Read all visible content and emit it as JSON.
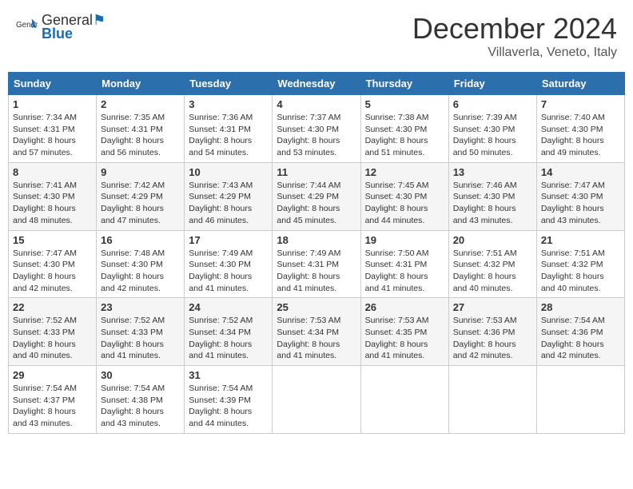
{
  "header": {
    "logo_general": "General",
    "logo_blue": "Blue",
    "month_title": "December 2024",
    "location": "Villaverla, Veneto, Italy"
  },
  "columns": [
    "Sunday",
    "Monday",
    "Tuesday",
    "Wednesday",
    "Thursday",
    "Friday",
    "Saturday"
  ],
  "weeks": [
    [
      {
        "day": "1",
        "sunrise": "7:34 AM",
        "sunset": "4:31 PM",
        "daylight": "8 hours and 57 minutes."
      },
      {
        "day": "2",
        "sunrise": "7:35 AM",
        "sunset": "4:31 PM",
        "daylight": "8 hours and 56 minutes."
      },
      {
        "day": "3",
        "sunrise": "7:36 AM",
        "sunset": "4:31 PM",
        "daylight": "8 hours and 54 minutes."
      },
      {
        "day": "4",
        "sunrise": "7:37 AM",
        "sunset": "4:30 PM",
        "daylight": "8 hours and 53 minutes."
      },
      {
        "day": "5",
        "sunrise": "7:38 AM",
        "sunset": "4:30 PM",
        "daylight": "8 hours and 51 minutes."
      },
      {
        "day": "6",
        "sunrise": "7:39 AM",
        "sunset": "4:30 PM",
        "daylight": "8 hours and 50 minutes."
      },
      {
        "day": "7",
        "sunrise": "7:40 AM",
        "sunset": "4:30 PM",
        "daylight": "8 hours and 49 minutes."
      }
    ],
    [
      {
        "day": "8",
        "sunrise": "7:41 AM",
        "sunset": "4:30 PM",
        "daylight": "8 hours and 48 minutes."
      },
      {
        "day": "9",
        "sunrise": "7:42 AM",
        "sunset": "4:29 PM",
        "daylight": "8 hours and 47 minutes."
      },
      {
        "day": "10",
        "sunrise": "7:43 AM",
        "sunset": "4:29 PM",
        "daylight": "8 hours and 46 minutes."
      },
      {
        "day": "11",
        "sunrise": "7:44 AM",
        "sunset": "4:29 PM",
        "daylight": "8 hours and 45 minutes."
      },
      {
        "day": "12",
        "sunrise": "7:45 AM",
        "sunset": "4:30 PM",
        "daylight": "8 hours and 44 minutes."
      },
      {
        "day": "13",
        "sunrise": "7:46 AM",
        "sunset": "4:30 PM",
        "daylight": "8 hours and 43 minutes."
      },
      {
        "day": "14",
        "sunrise": "7:47 AM",
        "sunset": "4:30 PM",
        "daylight": "8 hours and 43 minutes."
      }
    ],
    [
      {
        "day": "15",
        "sunrise": "7:47 AM",
        "sunset": "4:30 PM",
        "daylight": "8 hours and 42 minutes."
      },
      {
        "day": "16",
        "sunrise": "7:48 AM",
        "sunset": "4:30 PM",
        "daylight": "8 hours and 42 minutes."
      },
      {
        "day": "17",
        "sunrise": "7:49 AM",
        "sunset": "4:30 PM",
        "daylight": "8 hours and 41 minutes."
      },
      {
        "day": "18",
        "sunrise": "7:49 AM",
        "sunset": "4:31 PM",
        "daylight": "8 hours and 41 minutes."
      },
      {
        "day": "19",
        "sunrise": "7:50 AM",
        "sunset": "4:31 PM",
        "daylight": "8 hours and 41 minutes."
      },
      {
        "day": "20",
        "sunrise": "7:51 AM",
        "sunset": "4:32 PM",
        "daylight": "8 hours and 40 minutes."
      },
      {
        "day": "21",
        "sunrise": "7:51 AM",
        "sunset": "4:32 PM",
        "daylight": "8 hours and 40 minutes."
      }
    ],
    [
      {
        "day": "22",
        "sunrise": "7:52 AM",
        "sunset": "4:33 PM",
        "daylight": "8 hours and 40 minutes."
      },
      {
        "day": "23",
        "sunrise": "7:52 AM",
        "sunset": "4:33 PM",
        "daylight": "8 hours and 41 minutes."
      },
      {
        "day": "24",
        "sunrise": "7:52 AM",
        "sunset": "4:34 PM",
        "daylight": "8 hours and 41 minutes."
      },
      {
        "day": "25",
        "sunrise": "7:53 AM",
        "sunset": "4:34 PM",
        "daylight": "8 hours and 41 minutes."
      },
      {
        "day": "26",
        "sunrise": "7:53 AM",
        "sunset": "4:35 PM",
        "daylight": "8 hours and 41 minutes."
      },
      {
        "day": "27",
        "sunrise": "7:53 AM",
        "sunset": "4:36 PM",
        "daylight": "8 hours and 42 minutes."
      },
      {
        "day": "28",
        "sunrise": "7:54 AM",
        "sunset": "4:36 PM",
        "daylight": "8 hours and 42 minutes."
      }
    ],
    [
      {
        "day": "29",
        "sunrise": "7:54 AM",
        "sunset": "4:37 PM",
        "daylight": "8 hours and 43 minutes."
      },
      {
        "day": "30",
        "sunrise": "7:54 AM",
        "sunset": "4:38 PM",
        "daylight": "8 hours and 43 minutes."
      },
      {
        "day": "31",
        "sunrise": "7:54 AM",
        "sunset": "4:39 PM",
        "daylight": "8 hours and 44 minutes."
      },
      null,
      null,
      null,
      null
    ]
  ]
}
